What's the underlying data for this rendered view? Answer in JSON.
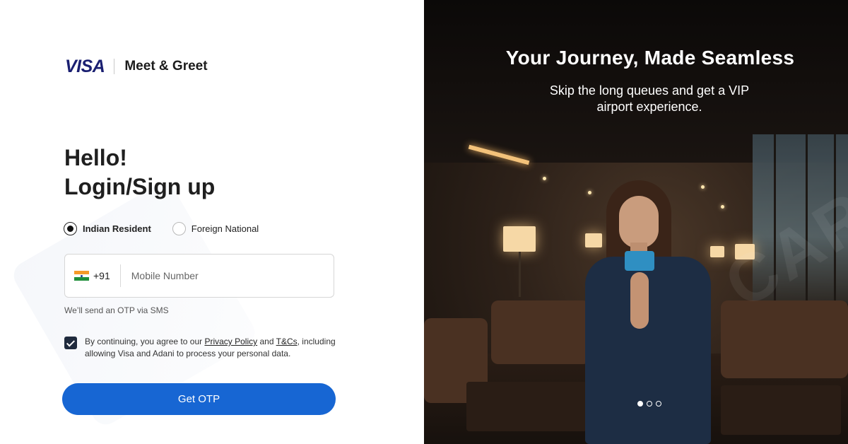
{
  "brand": {
    "logo_text": "VISA",
    "name": "Meet & Greet"
  },
  "login": {
    "greeting_line1": "Hello!",
    "greeting_line2": "Login/Sign up",
    "residency_options": [
      {
        "label": "Indian Resident",
        "selected": true
      },
      {
        "label": "Foreign National",
        "selected": false
      }
    ],
    "country_code": "+91",
    "country_flag": "india-flag-icon",
    "mobile_placeholder": "Mobile Number",
    "mobile_value": "",
    "otp_note": "We’ll send an OTP via SMS",
    "consent": {
      "checked": true,
      "prefix": "By continuing, you agree to our ",
      "privacy_link": "Privacy Policy",
      "and": " and ",
      "tnc_link": "T&Cs",
      "suffix": ", including allowing Visa and Adani to process your personal data."
    },
    "submit_label": "Get OTP"
  },
  "hero": {
    "title": "Your Journey, Made Seamless",
    "subtitle_line1": "Skip the long queues and get a VIP",
    "subtitle_line2": "airport experience.",
    "carousel_total": 3,
    "carousel_active": 1
  },
  "colors": {
    "primary_button": "#1766d3",
    "visa_blue": "#1a1f71",
    "checkbox_fill": "#1f2a3d"
  }
}
